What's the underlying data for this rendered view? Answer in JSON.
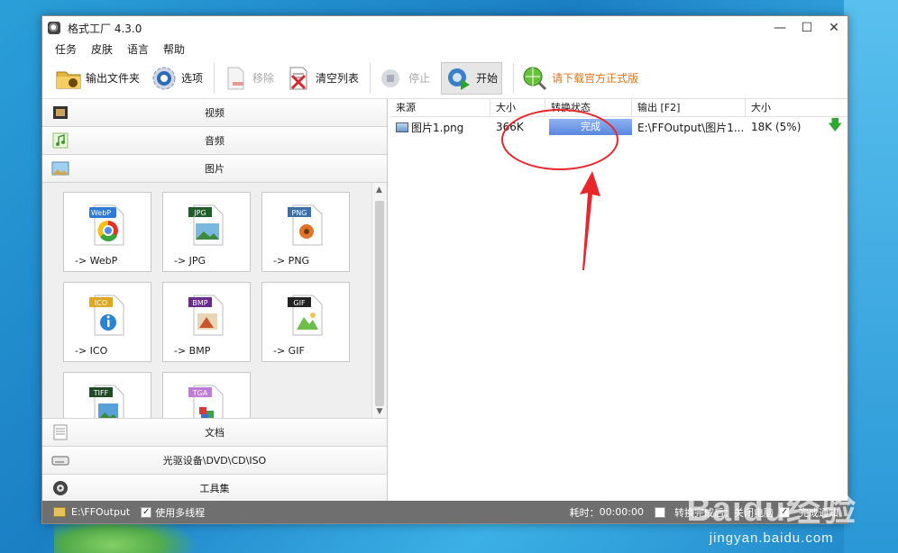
{
  "window": {
    "title": "格式工厂 4.3.0",
    "controls": {
      "minimize": "—",
      "maximize": "☐",
      "close": "✕"
    }
  },
  "menu": [
    "任务",
    "皮肤",
    "语言",
    "帮助"
  ],
  "toolbar": {
    "output_folder": "输出文件夹",
    "options": "选项",
    "remove": "移除",
    "clear_list": "清空列表",
    "stop": "停止",
    "start": "开始",
    "download": "请下载官方正式版"
  },
  "categories": {
    "video": "视频",
    "audio": "音频",
    "image": "图片",
    "document": "文档",
    "disc": "光驱设备\\DVD\\CD\\ISO",
    "tools": "工具集"
  },
  "image_formats": [
    {
      "label": "-> WebP",
      "badge": "WebP",
      "color": "#2f7ad6"
    },
    {
      "label": "-> JPG",
      "badge": "JPG",
      "color": "#1f5e28"
    },
    {
      "label": "-> PNG",
      "badge": "PNG",
      "color": "#3a6fa8"
    },
    {
      "label": "-> ICO",
      "badge": "ICO",
      "color": "#e0a820"
    },
    {
      "label": "-> BMP",
      "badge": "BMP",
      "color": "#6a2a8a"
    },
    {
      "label": "-> GIF",
      "badge": "GIF",
      "color": "#222222"
    },
    {
      "label": "",
      "badge": "TIFF",
      "color": "#1f4a22"
    },
    {
      "label": "",
      "badge": "TGA",
      "color": "#c07ad8"
    }
  ],
  "table": {
    "headers": [
      "来源",
      "大小",
      "转换状态",
      "输出 [F2]",
      "大小"
    ],
    "rows": [
      {
        "source": "图片1.png",
        "size": "366K",
        "status": "完成",
        "output": "E:\\FFOutput\\图片1...",
        "out_size": "18K",
        "ratio": "(5%)"
      }
    ]
  },
  "statusbar": {
    "output_path": "E:\\FFOutput",
    "multithread": "使用多线程",
    "elapsed_label": "耗时：",
    "elapsed_value": "00:00:00",
    "after_done": "转换完成后：关闭电脑",
    "notify": "完成通知"
  },
  "watermark": {
    "big": "Baidu经验",
    "small": "jingyan.baidu.com"
  }
}
